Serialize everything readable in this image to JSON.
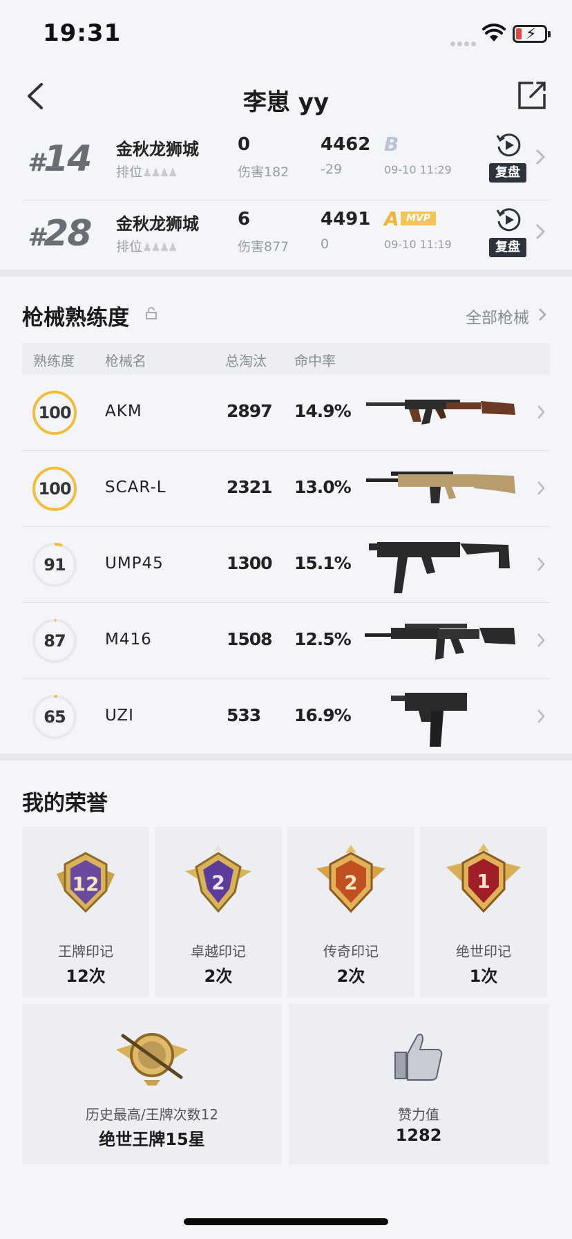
{
  "status": {
    "time": "19:31"
  },
  "nav": {
    "title": "李崽 yy"
  },
  "matches": [
    {
      "rank": "14",
      "map": "金秋龙狮城",
      "mode": "排位",
      "kills": "0",
      "damage": "伤害182",
      "score": "4462",
      "delta": "-29",
      "grade": "B",
      "mvp": "",
      "date": "09-10 11:29",
      "replay": "复盘"
    },
    {
      "rank": "28",
      "map": "金秋龙狮城",
      "mode": "排位",
      "kills": "6",
      "damage": "伤害877",
      "score": "4491",
      "delta": "0",
      "grade": "A",
      "mvp": "MVP",
      "date": "09-10 11:19",
      "replay": "复盘"
    }
  ],
  "weapons": {
    "title": "枪械熟练度",
    "all_label": "全部枪械",
    "headers": {
      "proficiency": "熟练度",
      "name": "枪械名",
      "kills": "总淘汰",
      "accuracy": "命中率"
    },
    "rows": [
      {
        "proficiency": 100,
        "progress": 1.0,
        "name": "AKM",
        "kills": "2897",
        "accuracy": "14.9%",
        "gun_icon": "akm-rifle"
      },
      {
        "proficiency": 100,
        "progress": 1.0,
        "name": "SCAR-L",
        "kills": "2321",
        "accuracy": "13.0%",
        "gun_icon": "scar-l-rifle"
      },
      {
        "proficiency": 91,
        "progress": 0.06,
        "name": "UMP45",
        "kills": "1300",
        "accuracy": "15.1%",
        "gun_icon": "ump45-smg"
      },
      {
        "proficiency": 87,
        "progress": 0.01,
        "name": "M416",
        "kills": "1508",
        "accuracy": "12.5%",
        "gun_icon": "m416-rifle"
      },
      {
        "proficiency": 65,
        "progress": 0.02,
        "name": "UZI",
        "kills": "533",
        "accuracy": "16.9%",
        "gun_icon": "uzi-smg"
      }
    ],
    "colors": {
      "ring_full": "#f0be3c",
      "ring_track": "#e8e9ed"
    }
  },
  "honor": {
    "title": "我的荣誉",
    "marks": [
      {
        "label": "王牌印记",
        "count": "12次",
        "badge_num": "12",
        "badge_color": "#6a4aa0"
      },
      {
        "label": "卓越印记",
        "count": "2次",
        "badge_num": "2",
        "badge_color": "#5b3c9a"
      },
      {
        "label": "传奇印记",
        "count": "2次",
        "badge_num": "2",
        "badge_color": "#c0501f"
      },
      {
        "label": "绝世印记",
        "count": "1次",
        "badge_num": "1",
        "badge_color": "#a01e28"
      }
    ],
    "best": {
      "label": "历史最高/王牌次数12",
      "value": "绝世王牌15星"
    },
    "likes": {
      "label": "赞力值",
      "value": "1282"
    }
  }
}
